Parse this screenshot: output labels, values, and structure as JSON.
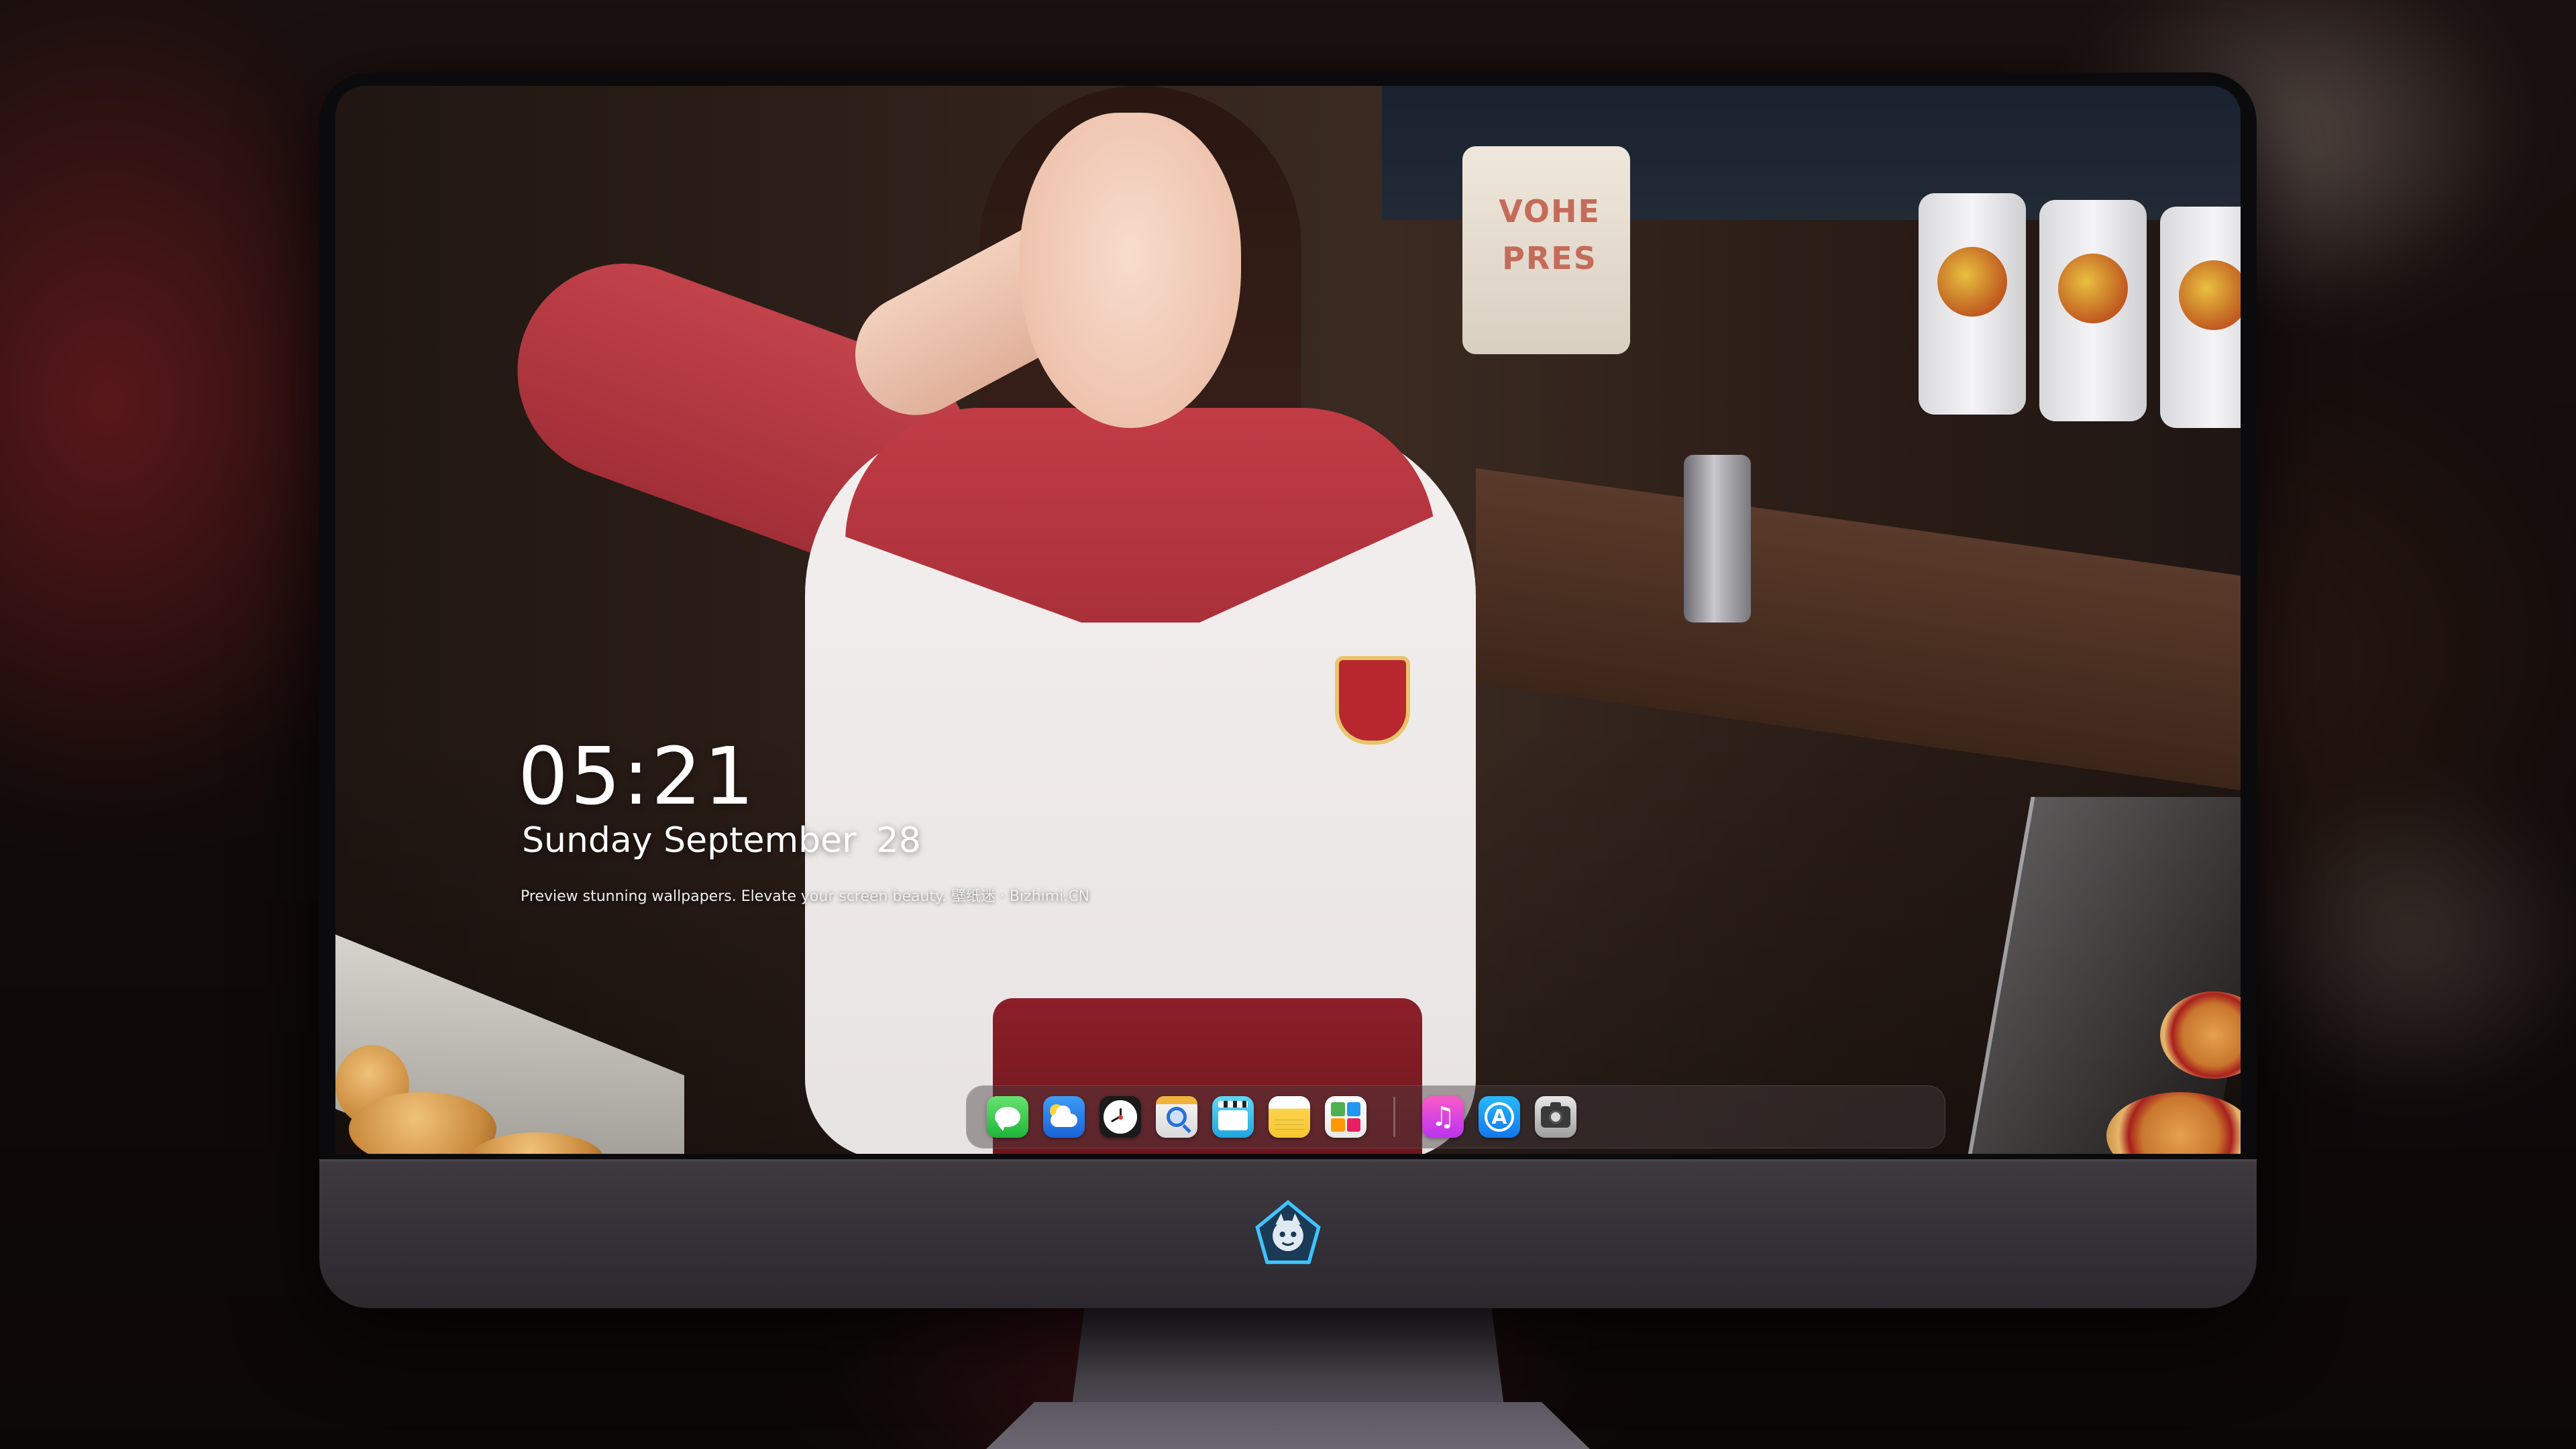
{
  "lockscreen": {
    "time": "05:21",
    "weekday_month": "Sunday September",
    "day": "28",
    "tagline": "Preview stunning wallpapers. Elevate your screen beauty. 壁纸迷 · Bizhimi.CN"
  },
  "wallpaper": {
    "sign_line1": "VOHE",
    "sign_line2": "PRES"
  },
  "dock": {
    "apps": [
      {
        "name": "messages",
        "icon": "messages-icon"
      },
      {
        "name": "weather",
        "icon": "weather-icon"
      },
      {
        "name": "clock",
        "icon": "clock-icon"
      },
      {
        "name": "preview",
        "icon": "preview-icon"
      },
      {
        "name": "video",
        "icon": "video-icon"
      },
      {
        "name": "notes",
        "icon": "notes-icon"
      },
      {
        "name": "photos",
        "icon": "photos-icon"
      },
      {
        "name": "music",
        "icon": "music-icon"
      },
      {
        "name": "app-store",
        "icon": "app-store-icon"
      },
      {
        "name": "camera",
        "icon": "camera-icon"
      }
    ]
  },
  "colors": {
    "chin": "#3e3a40",
    "bezel": "#0b0b0d",
    "logo_accent": "#3fc4ff"
  }
}
